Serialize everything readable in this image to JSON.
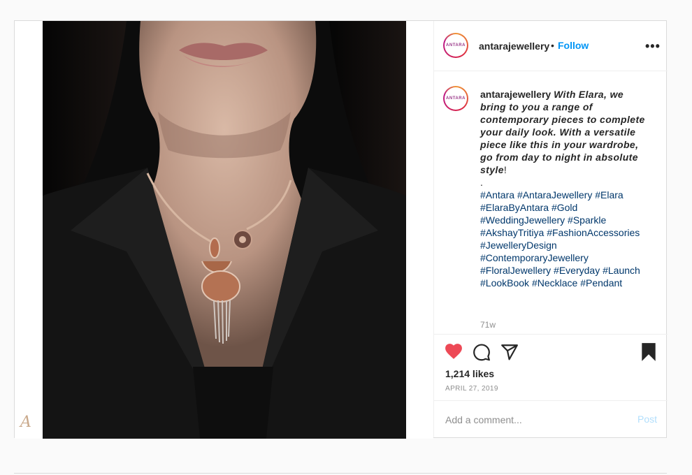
{
  "account": {
    "username": "antarajewellery",
    "follow_label": "Follow",
    "avatar_text": "ANTARA",
    "separator": "•"
  },
  "media": {
    "brand_mark": "A"
  },
  "caption": {
    "username": "antarajewellery",
    "text_1": "With",
    "text_name": "Elara",
    "text_2": ", we bring to you a range of contemporary pieces to complete your daily look. With a versatile piece like this in your wardrobe, go from day to night in absolute style",
    "text_end": "!",
    "dot_line": ".",
    "hashtags": [
      "#Antara",
      "#AntaraJewellery",
      "#Elara",
      "#ElaraByAntara",
      "#Gold",
      "#WeddingJewellery",
      "#Sparkle",
      "#AkshayTritiya",
      "#FashionAccessories",
      "#JewelleryDesign",
      "#ContemporaryJewellery",
      "#FloralJewellery",
      "#Everyday",
      "#Launch",
      "#LookBook",
      "#Necklace",
      "#Pendant"
    ],
    "age": "71w"
  },
  "stats": {
    "likes": "1,214 likes",
    "date": "APRIL 27, 2019"
  },
  "comment_form": {
    "placeholder": "Add a comment...",
    "post_label": "Post"
  },
  "colors": {
    "like_red": "#ed4956",
    "link_blue": "#0095f6",
    "hashtag": "#00376b"
  },
  "icons": [
    "heart-icon",
    "comment-icon",
    "share-icon",
    "bookmark-icon",
    "more-options-icon",
    "load-more-icon"
  ]
}
